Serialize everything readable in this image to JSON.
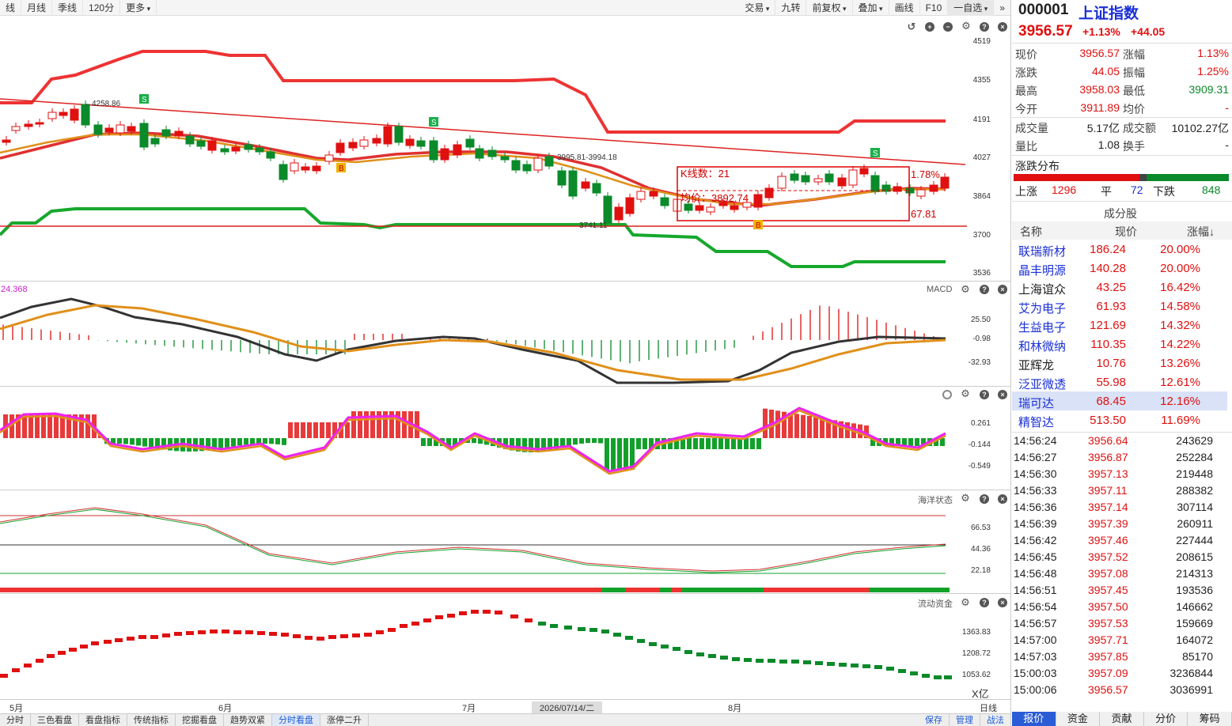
{
  "toolbar": {
    "left": [
      {
        "label": "线"
      },
      {
        "label": "月线"
      },
      {
        "label": "季线"
      },
      {
        "label": "120分"
      },
      {
        "label": "更多"
      }
    ],
    "right": [
      {
        "label": "交易"
      },
      {
        "label": "九转"
      },
      {
        "label": "前复权"
      },
      {
        "label": "叠加"
      },
      {
        "label": "画线"
      },
      {
        "label": "F10"
      },
      {
        "label": "一自选"
      }
    ]
  },
  "main": {
    "yticks": [
      "4519",
      "4355",
      "4191",
      "4027",
      "3864",
      "3700",
      "3536"
    ],
    "labels": {
      "high": "4258.86",
      "range": "3995.81-3994.18",
      "low": "3741.11",
      "kcount": "K线数：21",
      "avg": "均价：3892.74",
      "pct": "1.78%",
      "diff": "67.81"
    },
    "signals": {
      "s": "S",
      "b": "B"
    }
  },
  "macd": {
    "title": "MACD",
    "top_value": "24.368",
    "yticks": [
      "25.50",
      "-0.98",
      "-32.93"
    ]
  },
  "osc": {
    "yticks": [
      "0.261",
      "-0.144",
      "-0.549"
    ]
  },
  "ocean": {
    "title": "海洋状态",
    "yticks": [
      "66.53",
      "44.36",
      "22.18"
    ]
  },
  "flow": {
    "title": "流动资金",
    "yticks": [
      "1363.83",
      "1208.72",
      "1053.62"
    ],
    "unit": "X亿"
  },
  "xaxis": {
    "labels": [
      "5月",
      "6月",
      "7月",
      "2026/07/14/二",
      "8月"
    ],
    "right": "日线"
  },
  "bottom_tabs": [
    "分时",
    "三色看盘",
    "看盘指标",
    "传统指标",
    "挖掘看盘",
    "趋势双紧",
    "分时看盘",
    "涨停二升",
    "保存",
    "管理",
    "战法"
  ],
  "quote": {
    "code": "000001",
    "name": "上证指数",
    "price": "3956.57",
    "pct": "+1.13%",
    "chg": "+44.05",
    "rows": [
      [
        "现价",
        "3956.57",
        "涨幅",
        "1.13%"
      ],
      [
        "涨跌",
        "44.05",
        "振幅",
        "1.25%"
      ],
      [
        "最高",
        "3958.03",
        "最低",
        "3909.31"
      ],
      [
        "今开",
        "3911.89",
        "均价",
        "-"
      ]
    ],
    "vol_rows": [
      [
        "成交量",
        "5.17亿",
        "成交额",
        "10102.27亿"
      ],
      [
        "量比",
        "1.08",
        "换手",
        "-"
      ]
    ],
    "dist_title": "涨跌分布",
    "up_label": "上涨",
    "up": "1296",
    "flat_label": "平",
    "flat": "72",
    "down_label": "下跌",
    "down": "848",
    "comp_title": "成分股",
    "comp_headers": [
      "名称",
      "现价",
      "涨幅↓"
    ],
    "comps": [
      [
        "联瑞新材",
        "186.24",
        "20.00%"
      ],
      [
        "晶丰明源",
        "140.28",
        "20.00%"
      ],
      [
        "上海谊众",
        "43.25",
        "16.42%"
      ],
      [
        "艾为电子",
        "61.93",
        "14.58%"
      ],
      [
        "生益电子",
        "121.69",
        "14.32%"
      ],
      [
        "和林微纳",
        "110.35",
        "14.22%"
      ],
      [
        "亚辉龙",
        "10.76",
        "13.26%"
      ],
      [
        "泛亚微透",
        "55.98",
        "12.61%"
      ],
      [
        "瑞可达",
        "68.45",
        "12.16%"
      ],
      [
        "精智达",
        "513.50",
        "11.69%"
      ]
    ],
    "ticks": [
      [
        "14:56:24",
        "3956.64",
        "243629"
      ],
      [
        "14:56:27",
        "3956.87",
        "252284"
      ],
      [
        "14:56:30",
        "3957.13",
        "219448"
      ],
      [
        "14:56:33",
        "3957.11",
        "288382"
      ],
      [
        "14:56:36",
        "3957.14",
        "307114"
      ],
      [
        "14:56:39",
        "3957.39",
        "260911"
      ],
      [
        "14:56:42",
        "3957.46",
        "227444"
      ],
      [
        "14:56:45",
        "3957.52",
        "208615"
      ],
      [
        "14:56:48",
        "3957.08",
        "214313"
      ],
      [
        "14:56:51",
        "3957.45",
        "193536"
      ],
      [
        "14:56:54",
        "3957.50",
        "146662"
      ],
      [
        "14:56:57",
        "3957.53",
        "159669"
      ],
      [
        "14:57:00",
        "3957.71",
        "164072"
      ],
      [
        "14:57:03",
        "3957.85",
        "85170"
      ],
      [
        "15:00:03",
        "3957.09",
        "3236844"
      ],
      [
        "15:00:06",
        "3956.57",
        "3036991"
      ]
    ],
    "bottom": [
      "报价",
      "资金",
      "贡献",
      "分价",
      "筹码"
    ]
  },
  "colors": {
    "up": "#e01010",
    "down": "#0a8a2a",
    "ma1": "#e03030",
    "ma2": "#e0901a",
    "magenta": "#ee22ee"
  }
}
